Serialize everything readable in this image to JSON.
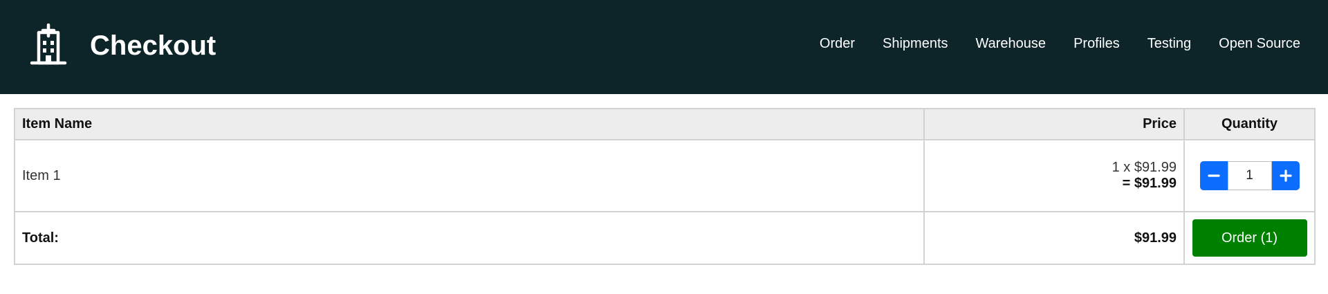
{
  "header": {
    "title": "Checkout",
    "logo_icon": "hospital-building-icon",
    "background": "#0d2529",
    "nav": [
      {
        "label": "Order"
      },
      {
        "label": "Shipments"
      },
      {
        "label": "Warehouse"
      },
      {
        "label": "Profiles"
      },
      {
        "label": "Testing"
      },
      {
        "label": "Open Source"
      }
    ]
  },
  "table": {
    "columns": {
      "name": "Item Name",
      "price": "Price",
      "quantity": "Quantity"
    },
    "items": [
      {
        "name": "Item 1",
        "unit_price": "1 x $91.99",
        "line_total": "= $91.99",
        "quantity": "1"
      }
    ],
    "total": {
      "label": "Total:",
      "value": "$91.99"
    }
  },
  "controls": {
    "decrement_icon": "minus-icon",
    "increment_icon": "plus-icon",
    "order_button": "Order (1)",
    "accent_color": "#0d6efd",
    "order_color": "#008000"
  }
}
